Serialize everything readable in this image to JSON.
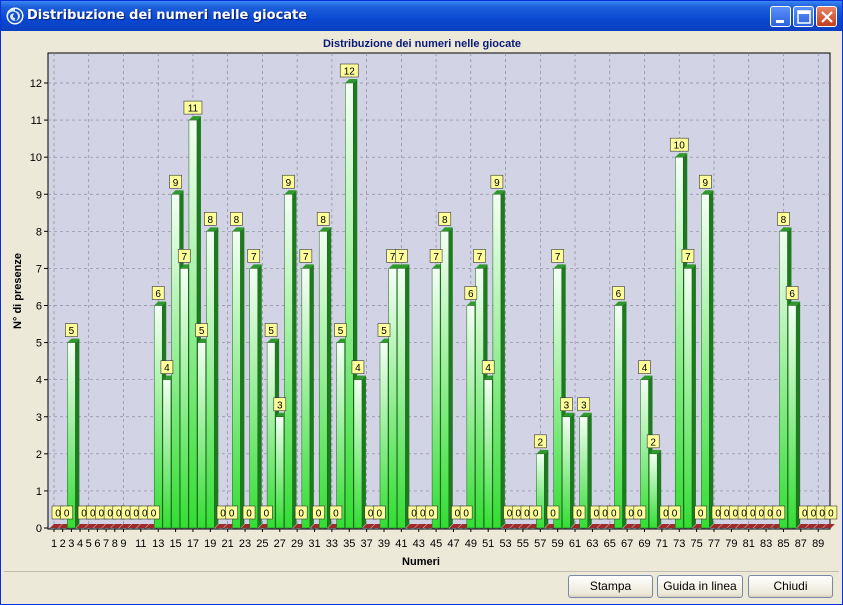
{
  "window": {
    "title": "Distribuzione dei numeri nelle giocate",
    "icon": "app-swirl-icon",
    "controls": [
      "minimize-icon",
      "maximize-icon",
      "close-icon"
    ]
  },
  "buttons": {
    "stampa": "Stampa",
    "guida": "Guida in linea",
    "chiudi": "Chiudi"
  },
  "colors": {
    "bar_front": "#33dd33",
    "bar_side": "#1e7a1e",
    "bar_zero": "#9e2a2a",
    "label_bg": "#ffff99",
    "plot_bg": "#d3d3e6"
  },
  "chart_data": {
    "type": "bar",
    "title": "Distribuzione dei numeri nelle giocate",
    "xlabel": "Numeri",
    "ylabel": "N° di presenze",
    "ylim": [
      0,
      12
    ],
    "grid": true,
    "yticks": [
      0,
      1,
      2,
      3,
      4,
      5,
      6,
      7,
      8,
      9,
      10,
      11,
      12
    ],
    "x_tick_labels": [
      "1",
      "2",
      "3",
      "4",
      "5",
      "6",
      "7",
      "8",
      "9",
      "11",
      "13",
      "15",
      "17",
      "19",
      "21",
      "23",
      "25",
      "27",
      "29",
      "31",
      "33",
      "35",
      "37",
      "39",
      "41",
      "43",
      "45",
      "47",
      "49",
      "51",
      "53",
      "55",
      "57",
      "59",
      "61",
      "63",
      "65",
      "67",
      "69",
      "71",
      "73",
      "75",
      "77",
      "79",
      "81",
      "83",
      "85",
      "87",
      "89"
    ],
    "categories": [
      1,
      2,
      3,
      4,
      5,
      6,
      7,
      8,
      9,
      10,
      11,
      12,
      13,
      14,
      15,
      16,
      17,
      18,
      19,
      20,
      21,
      22,
      23,
      24,
      25,
      26,
      27,
      28,
      29,
      30,
      31,
      32,
      33,
      34,
      35,
      36,
      37,
      38,
      39,
      40,
      41,
      42,
      43,
      44,
      45,
      46,
      47,
      48,
      49,
      50,
      51,
      52,
      53,
      54,
      55,
      56,
      57,
      58,
      59,
      60,
      61,
      62,
      63,
      64,
      65,
      66,
      67,
      68,
      69,
      70,
      71,
      72,
      73,
      74,
      75,
      76,
      77,
      78,
      79,
      80,
      81,
      82,
      83,
      84,
      85,
      86,
      87,
      88,
      89,
      90
    ],
    "values": [
      0,
      0,
      5,
      0,
      0,
      0,
      0,
      0,
      0,
      0,
      0,
      0,
      6,
      4,
      9,
      7,
      11,
      5,
      8,
      0,
      0,
      8,
      0,
      7,
      0,
      5,
      3,
      9,
      0,
      7,
      0,
      8,
      0,
      5,
      12,
      4,
      0,
      0,
      5,
      7,
      7,
      0,
      0,
      0,
      7,
      8,
      0,
      0,
      6,
      7,
      4,
      9,
      0,
      0,
      0,
      0,
      2,
      0,
      7,
      3,
      0,
      3,
      0,
      0,
      0,
      6,
      0,
      0,
      4,
      2,
      0,
      0,
      10,
      7,
      0,
      9,
      0,
      0,
      0,
      0,
      0,
      0,
      0,
      0,
      8,
      6,
      0,
      0,
      0,
      0
    ],
    "data_labels": true
  }
}
